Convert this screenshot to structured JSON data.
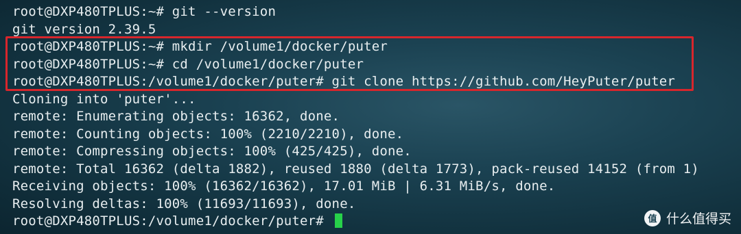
{
  "terminal": {
    "lines": [
      "root@DXP480TPLUS:~# git --version",
      "git version 2.39.5",
      "root@DXP480TPLUS:~# mkdir /volume1/docker/puter",
      "root@DXP480TPLUS:~# cd /volume1/docker/puter",
      "root@DXP480TPLUS:/volume1/docker/puter# git clone https://github.com/HeyPuter/puter",
      "Cloning into 'puter'...",
      "remote: Enumerating objects: 16362, done.",
      "remote: Counting objects: 100% (2210/2210), done.",
      "remote: Compressing objects: 100% (425/425), done.",
      "remote: Total 16362 (delta 1882), reused 1880 (delta 1773), pack-reused 14152 (from 1)",
      "Receiving objects: 100% (16362/16362), 17.01 MiB | 6.31 MiB/s, done.",
      "Resolving deltas: 100% (11693/11693), done."
    ],
    "prompt": "root@DXP480TPLUS:/volume1/docker/puter# ",
    "cursor_color": "#27d14a",
    "highlight_color": "#d8262c"
  },
  "watermark": {
    "logo_text": "值",
    "text": "什么值得买"
  }
}
